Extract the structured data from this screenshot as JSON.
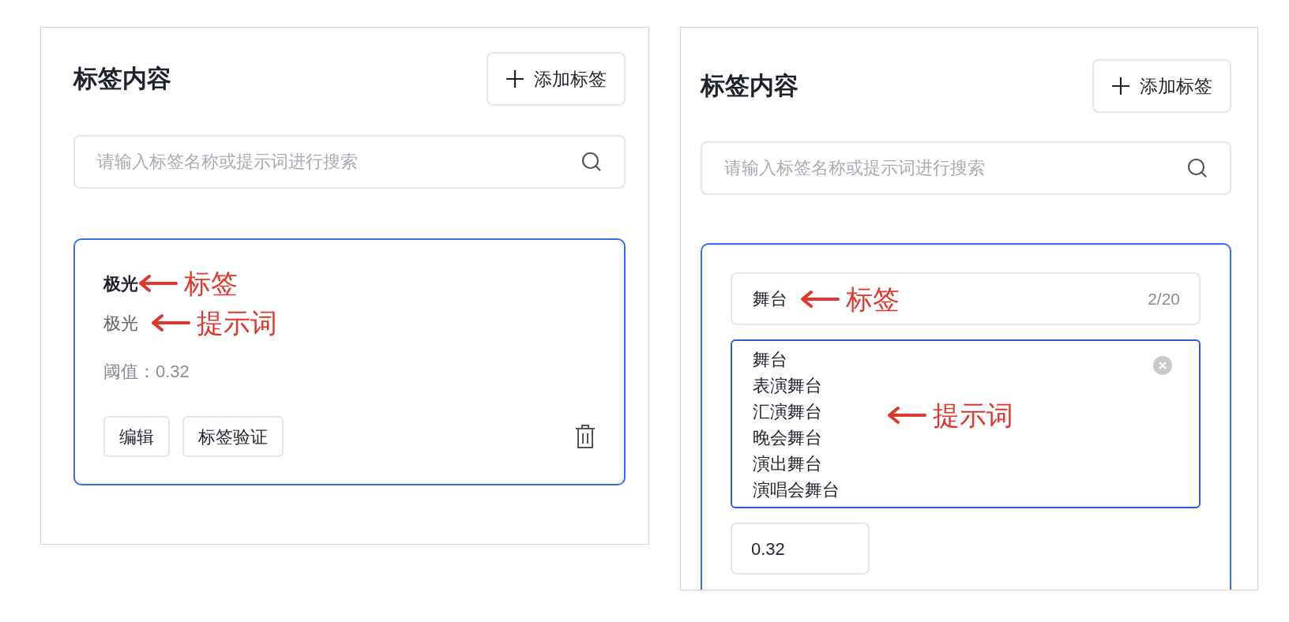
{
  "panels": [
    {
      "title": "标签内容",
      "add_button": "添加标签",
      "search": {
        "placeholder": "请输入标签名称或提示词进行搜索"
      },
      "card": {
        "kind": "view",
        "selected": true,
        "tag": "极光",
        "tag_note": "标签",
        "prompt": "极光",
        "prompt_note": "提示词",
        "threshold": "阈值：0.32",
        "buttons": [
          "编辑",
          "标签验证"
        ]
      }
    },
    {
      "title": "标签内容",
      "add_button": "添加标签",
      "search": {
        "placeholder": "请输入标签名称或提示词进行搜索"
      },
      "card": {
        "kind": "edit",
        "selected": true,
        "tag": "舞台",
        "tag_note": "标签",
        "counter": "2/20",
        "prompts": [
          "舞台",
          "表演舞台",
          "汇演舞台",
          "晚会舞台",
          "演出舞台",
          "演唱会舞台"
        ],
        "prompt_note": "提示词",
        "threshold": "0.32"
      }
    }
  ]
}
